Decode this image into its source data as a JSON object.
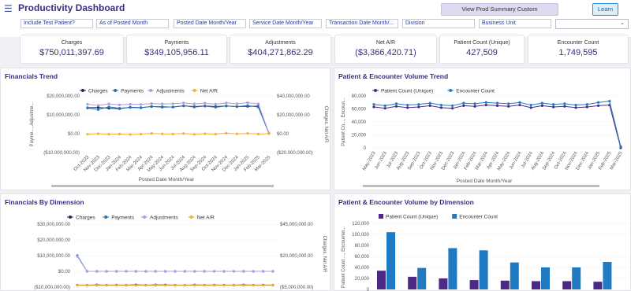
{
  "header": {
    "title": "Productivity Dashboard",
    "prod_summary_button": "View Prod Summary Custom",
    "learn_button": "Learn"
  },
  "filters": [
    "Include Test Patient?",
    "As of Posted Month",
    "Posted Date Month/Year",
    "Service Date Month/Year",
    "Transaction Date Month/...",
    "Division",
    "Business Unit"
  ],
  "kpis": [
    {
      "label": "Charges",
      "value": "$750,011,397.69"
    },
    {
      "label": "Payments",
      "value": "$349,105,956.11"
    },
    {
      "label": "Adjustments",
      "value": "$404,271,862.29"
    },
    {
      "label": "Net A/R",
      "value": "($3,366,420.71)"
    },
    {
      "label": "Patient Count (Unique)",
      "value": "427,509"
    },
    {
      "label": "Encounter Count",
      "value": "1,749,595"
    }
  ],
  "colors": {
    "charges": "#1f2a5c",
    "payments": "#2474b4",
    "adjustments": "#a99bdc",
    "net_ar": "#f4b22a",
    "patient": "#4a2a85",
    "encounter": "#1f7ac2",
    "title": "#3d2b82"
  },
  "panels": {
    "fin_trend": "Financials Trend",
    "pe_trend": "Patient & Encounter Volume Trend",
    "fin_dim": "Financials By Dimension",
    "pe_dim": "Patient & Encounter Volume by Dimension"
  },
  "chart_data": [
    {
      "type": "line",
      "title": "Financials Trend",
      "xlabel": "Posted Date Month/Year",
      "ylabel_left": "Payme..., Adjustme...",
      "ylabel_right": "Charges, Net A/R",
      "left_ticks": [
        "$20,000,000.00",
        "$10,000,000.00",
        "$0.00",
        "($10,000,000.00)"
      ],
      "right_ticks": [
        "$40,000,000.00",
        "$20,000,000.00",
        "$0.00",
        "($20,000,000.00)"
      ],
      "ylim_left": [
        -10000000,
        20000000
      ],
      "ylim_right": [
        -20000000,
        40000000
      ],
      "x": [
        "Oct-2023",
        "Nov-2023",
        "Dec-2023",
        "Jan-2024",
        "Feb-2024",
        "Mar-2024",
        "Apr-2024",
        "May-2024",
        "Jun-2024",
        "Jul-2024",
        "Aug-2024",
        "Sep-2024",
        "Oct-2024",
        "Nov-2024",
        "Dec-2024",
        "Jan-2025",
        "Feb-2025",
        "Mar-2025"
      ],
      "series": [
        {
          "name": "Charges",
          "axis": "right",
          "values": [
            27500000,
            27800000,
            27000000,
            26500000,
            28000000,
            27600000,
            28800000,
            28500000,
            28200000,
            29500000,
            28700000,
            29400000,
            28700000,
            29400000,
            28800000,
            29000000,
            29200000,
            500000
          ]
        },
        {
          "name": "Payments",
          "axis": "left",
          "values": [
            13600000,
            12800000,
            14200000,
            13500000,
            13900000,
            13700000,
            14500000,
            14000000,
            14200000,
            14800000,
            14100000,
            14600000,
            14000000,
            14700000,
            14300000,
            14900000,
            14100000,
            200000
          ]
        },
        {
          "name": "Adjustments",
          "axis": "left",
          "values": [
            15600000,
            15000000,
            15800000,
            15300000,
            15600000,
            15500000,
            16000000,
            15800000,
            15900000,
            16300000,
            15800000,
            16200000,
            15700000,
            16300000,
            15900000,
            16400000,
            15800000,
            300000
          ]
        },
        {
          "name": "Net A/R",
          "axis": "right",
          "values": [
            -500000,
            0,
            -500000,
            -300000,
            -800000,
            -400000,
            300000,
            -200000,
            -300000,
            200000,
            -600000,
            0,
            -400000,
            600000,
            -200000,
            300000,
            -300000,
            0
          ]
        }
      ]
    },
    {
      "type": "line",
      "title": "Patient & Encounter Volume Trend",
      "xlabel": "Posted Date Month/Year",
      "ylabel": "Patient Co..., Encoun...",
      "y_ticks": [
        "80,000",
        "60,000",
        "40,000",
        "20,000",
        "0"
      ],
      "ylim": [
        0,
        80000
      ],
      "x": [
        "May-2023",
        "Jun-2023",
        "Jul-2023",
        "Aug-2023",
        "Sep-2023",
        "Oct-2023",
        "Nov-2023",
        "Dec-2023",
        "Jan-2024",
        "Feb-2024",
        "Mar-2024",
        "Apr-2024",
        "May-2024",
        "Jun-2024",
        "Jul-2024",
        "Aug-2024",
        "Sep-2024",
        "Oct-2024",
        "Nov-2024",
        "Dec-2024",
        "Jan-2025",
        "Feb-2025",
        "Mar-2025"
      ],
      "series": [
        {
          "name": "Patient Count (Unique)",
          "values": [
            63000,
            61000,
            64000,
            62000,
            63000,
            65000,
            62000,
            61000,
            65000,
            64000,
            66000,
            65000,
            64000,
            66000,
            62000,
            65000,
            63000,
            64000,
            62000,
            63000,
            65000,
            66000,
            0
          ]
        },
        {
          "name": "Encounter Count",
          "values": [
            67000,
            65000,
            68000,
            66000,
            67000,
            69000,
            66000,
            65000,
            69000,
            68000,
            70000,
            69000,
            68000,
            70000,
            66000,
            69000,
            67000,
            68000,
            66000,
            67000,
            70000,
            72000,
            2000
          ]
        }
      ]
    },
    {
      "type": "line",
      "title": "Financials By Dimension",
      "ylabel_right": "Charges, Net A/R",
      "left_ticks": [
        "$30,000,000.00",
        "$20,000,000.00",
        "$10,000,000.00",
        "$0.00",
        "($10,000,000.00)"
      ],
      "right_ticks": [
        "$45,000,000.00",
        "$20,000,000.00",
        "($5,000,000.00)"
      ],
      "ylim_left": [
        -10000000,
        30000000
      ],
      "ylim_right": [
        -5000000,
        45000000
      ],
      "series": [
        {
          "name": "Charges",
          "axis": "right",
          "values": [
            -3400000,
            -3500000,
            -3300000,
            -3400000,
            -3350000,
            -3450000,
            -3200000,
            -3400000,
            -3300000,
            -3250000,
            -3400000,
            -3500000,
            -3300000,
            -3400000,
            -3350000,
            -3450000,
            -3400000,
            -3300000,
            -3400000,
            -3350000,
            -3450000
          ]
        },
        {
          "name": "Payments",
          "axis": "left",
          "values": [
            10000000,
            0,
            0,
            0,
            0,
            0,
            0,
            0,
            0,
            0,
            0,
            0,
            0,
            0,
            0,
            0,
            0,
            0,
            0,
            0,
            0
          ]
        },
        {
          "name": "Adjustments",
          "axis": "left",
          "values": [
            9500000,
            0,
            0,
            0,
            0,
            0,
            0,
            0,
            0,
            0,
            0,
            0,
            0,
            0,
            0,
            0,
            0,
            0,
            0,
            0,
            0
          ]
        },
        {
          "name": "Net A/R",
          "axis": "right",
          "values": [
            -3600000,
            -3600000,
            -3600000,
            -3600000,
            -3600000,
            -3600000,
            -3600000,
            -3600000,
            -3600000,
            -3600000,
            -3600000,
            -3600000,
            -3600000,
            -3600000,
            -3600000,
            -3600000,
            -3600000,
            -3600000,
            -3600000,
            -3600000,
            -3600000
          ]
        }
      ]
    },
    {
      "type": "bar",
      "title": "Patient & Encounter Volume by Dimension",
      "ylabel": "Patient Count ..., Encounter...",
      "y_ticks": [
        "120,000",
        "100,000",
        "80,000",
        "60,000",
        "40,000",
        "20,000",
        "0"
      ],
      "ylim": [
        0,
        120000
      ],
      "series": [
        {
          "name": "Patient Count (Unique)",
          "values": [
            34000,
            23000,
            20000,
            17000,
            16000,
            15000,
            15000,
            14000
          ]
        },
        {
          "name": "Encounter Count",
          "values": [
            104000,
            39000,
            75000,
            71000,
            49000,
            40000,
            40000,
            50000
          ]
        }
      ]
    }
  ]
}
